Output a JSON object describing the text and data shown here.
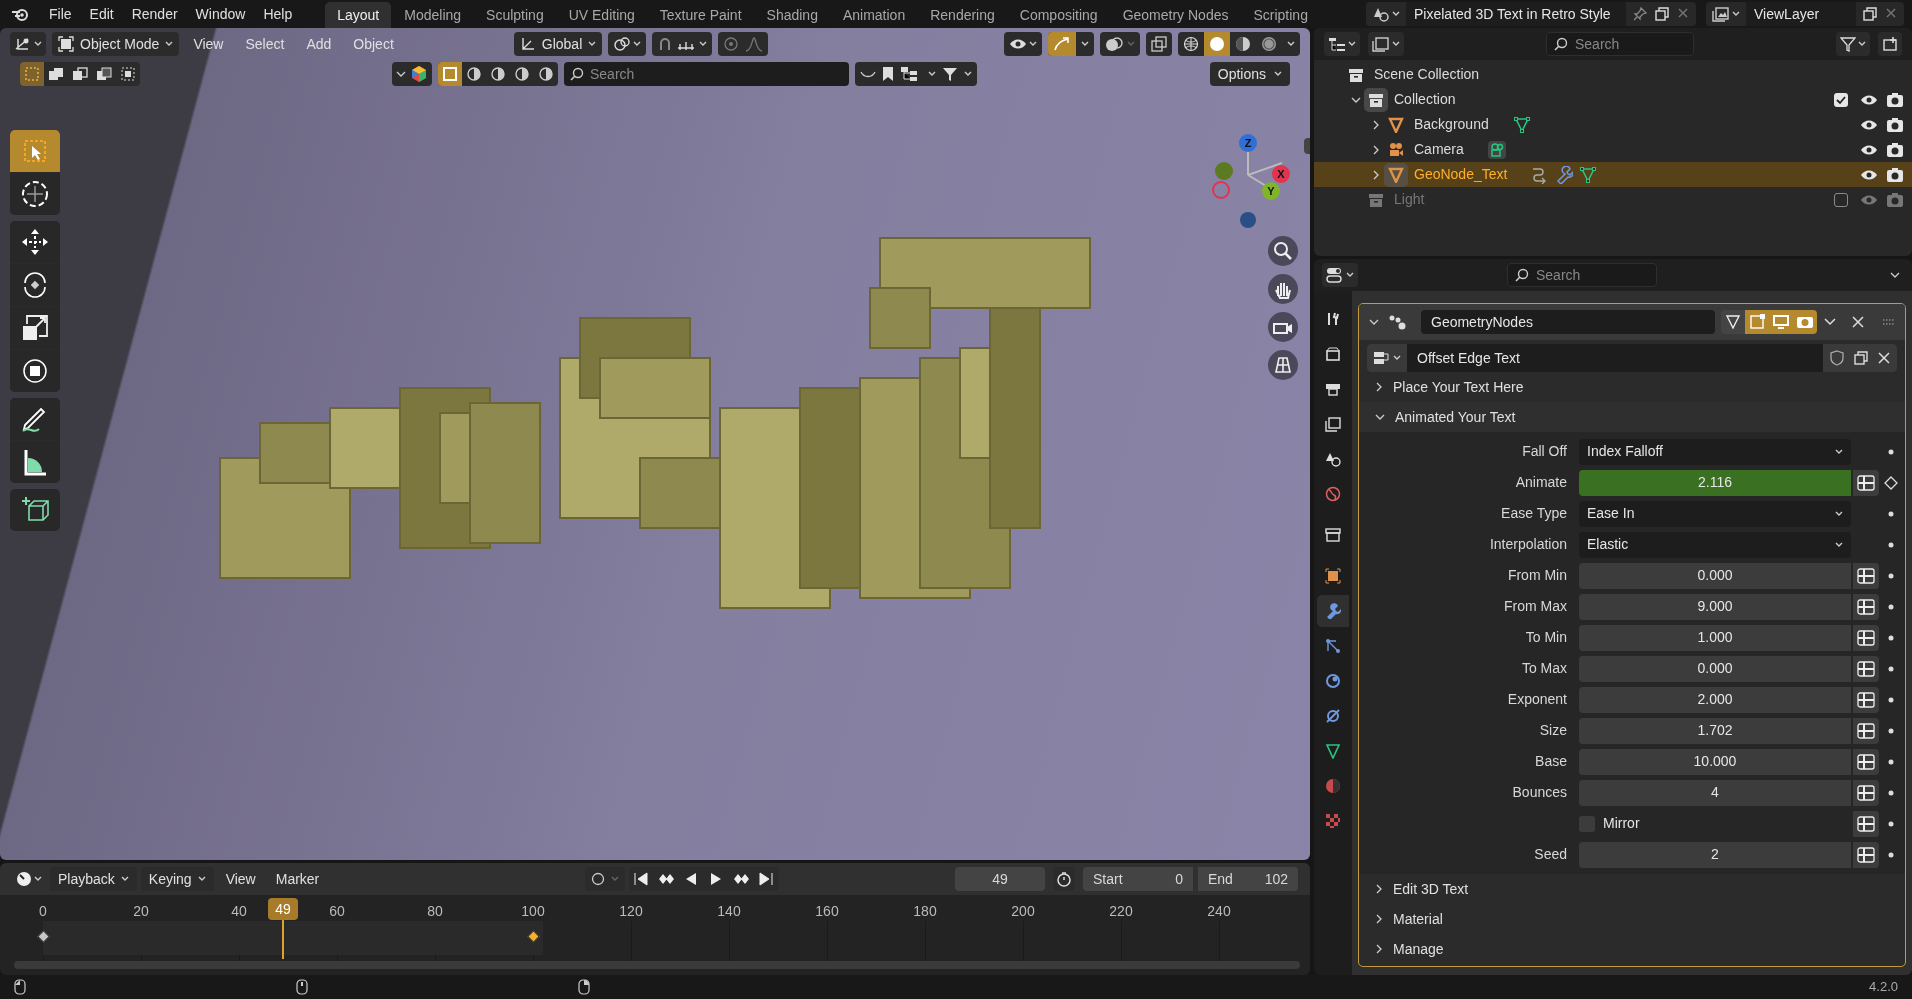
{
  "menu": [
    "File",
    "Edit",
    "Render",
    "Window",
    "Help"
  ],
  "workspaces": [
    {
      "label": "Layout",
      "selected": true
    },
    {
      "label": "Modeling",
      "selected": false
    },
    {
      "label": "Sculpting",
      "selected": false
    },
    {
      "label": "UV Editing",
      "selected": false
    },
    {
      "label": "Texture Paint",
      "selected": false
    },
    {
      "label": "Shading",
      "selected": false
    },
    {
      "label": "Animation",
      "selected": false
    },
    {
      "label": "Rendering",
      "selected": false
    },
    {
      "label": "Compositing",
      "selected": false
    },
    {
      "label": "Geometry Nodes",
      "selected": false
    },
    {
      "label": "Scripting",
      "selected": false
    }
  ],
  "scene": {
    "name": "Pixelated 3D Text in Retro Style"
  },
  "view_layer": {
    "name": "ViewLayer"
  },
  "viewport": {
    "mode": "Object Mode",
    "menus": [
      "View",
      "Select",
      "Add",
      "Object"
    ],
    "orientation": "Global",
    "search_placeholder": "Search",
    "options": "Options",
    "shading_modes": [
      {
        "kind": "wireframe",
        "selected": false
      },
      {
        "kind": "solid",
        "selected": true
      },
      {
        "kind": "material",
        "selected": false
      },
      {
        "kind": "rendered",
        "selected": false
      }
    ],
    "select_modes": [
      {
        "kind": "new",
        "selected": true
      },
      {
        "kind": "extend",
        "selected": false
      },
      {
        "kind": "subtract",
        "selected": false
      },
      {
        "kind": "invert",
        "selected": false
      },
      {
        "kind": "intersect",
        "selected": false
      }
    ],
    "tools": [
      {
        "kind": "select",
        "selected": true
      },
      {
        "kind": "cursor",
        "selected": false
      },
      {
        "kind": "move",
        "selected": false
      },
      {
        "kind": "rotate",
        "selected": false
      },
      {
        "kind": "scale",
        "selected": false
      },
      {
        "kind": "transform",
        "selected": false
      },
      {
        "kind": "annotate",
        "selected": false
      },
      {
        "kind": "measure",
        "selected": false
      },
      {
        "kind": "add-cube",
        "selected": false
      }
    ],
    "gizmo_axes": [
      {
        "label": "Z",
        "color": "#2f6fd6"
      },
      {
        "label": "X",
        "color": "#e0344f"
      },
      {
        "label": "Y",
        "color": "#80b52a"
      }
    ]
  },
  "outliner": {
    "search_placeholder": "Search",
    "items": [
      {
        "label": "Scene Collection",
        "kind": "collection",
        "children": [
          {
            "label": "Collection",
            "kind": "collection",
            "expanded": true,
            "included": true,
            "children": [
              {
                "label": "Background",
                "kind": "mesh",
                "expanded": false,
                "selected": false,
                "badges": [
                  {
                    "kind": "mesh-data"
                  }
                ]
              },
              {
                "label": "Camera",
                "kind": "camera",
                "expanded": false,
                "selected": false,
                "badges": [
                  {
                    "kind": "camera-data"
                  }
                ]
              },
              {
                "label": "GeoNode_Text",
                "kind": "mesh",
                "expanded": false,
                "selected": true,
                "badges": [
                  {
                    "kind": "curve"
                  },
                  {
                    "kind": "modifier"
                  },
                  {
                    "kind": "mesh-data"
                  }
                ]
              }
            ]
          },
          {
            "label": "Light",
            "kind": "collection",
            "included": false
          }
        ]
      }
    ]
  },
  "properties": {
    "search_placeholder": "Search",
    "tabs": [
      {
        "kind": "tool",
        "selected": false
      },
      {
        "kind": "render",
        "selected": false
      },
      {
        "kind": "output",
        "selected": false
      },
      {
        "kind": "view-layer",
        "selected": false
      },
      {
        "kind": "scene",
        "selected": false
      },
      {
        "kind": "world",
        "selected": false
      },
      {
        "kind": "collection",
        "selected": false
      },
      {
        "kind": "object",
        "selected": false
      },
      {
        "kind": "modifier",
        "selected": true
      },
      {
        "kind": "particles",
        "selected": false
      },
      {
        "kind": "physics",
        "selected": false
      },
      {
        "kind": "constraints",
        "selected": false
      },
      {
        "kind": "data",
        "selected": false
      },
      {
        "kind": "material",
        "selected": false
      },
      {
        "kind": "texture",
        "selected": false
      }
    ],
    "modifier": {
      "name": "GeometryNodes",
      "expanded": true,
      "node_group": "Offset Edge Text",
      "panels": [
        {
          "label": "Place Your Text Here",
          "expanded": false
        },
        {
          "label": "Animated Your Text",
          "expanded": true,
          "fields": [
            {
              "kind": "dropdown",
              "label": "Fall Off",
              "value": "Index Falloff",
              "keyed": false
            },
            {
              "kind": "number",
              "label": "Animate",
              "value": "2.116",
              "keyed": true
            },
            {
              "kind": "dropdown",
              "label": "Ease Type",
              "value": "Ease In",
              "keyed": false
            },
            {
              "kind": "dropdown",
              "label": "Interpolation",
              "value": "Elastic",
              "keyed": false
            },
            {
              "kind": "number",
              "label": "From Min",
              "value": "0.000",
              "keyed": false
            },
            {
              "kind": "number",
              "label": "From Max",
              "value": "9.000",
              "keyed": false
            },
            {
              "kind": "number",
              "label": "To Min",
              "value": "1.000",
              "keyed": false
            },
            {
              "kind": "number",
              "label": "To Max",
              "value": "0.000",
              "keyed": false
            },
            {
              "kind": "number",
              "label": "Exponent",
              "value": "2.000",
              "keyed": false
            },
            {
              "kind": "number",
              "label": "Size",
              "value": "1.702",
              "keyed": false
            },
            {
              "kind": "number",
              "label": "Base",
              "value": "10.000",
              "keyed": false
            },
            {
              "kind": "number",
              "label": "Bounces",
              "value": "4",
              "keyed": false
            },
            {
              "kind": "checkbox",
              "label": "Mirror",
              "checked": false,
              "keyed": false
            },
            {
              "kind": "number",
              "label": "Seed",
              "value": "2",
              "keyed": false
            }
          ]
        },
        {
          "label": "Edit 3D Text",
          "expanded": false
        },
        {
          "label": "Material",
          "expanded": false
        },
        {
          "label": "Manage",
          "expanded": false
        }
      ]
    }
  },
  "timeline": {
    "menus": [
      "Playback",
      "Keying",
      "View",
      "Marker"
    ],
    "current_frame": "49",
    "start_label": "Start",
    "start": "0",
    "end_label": "End",
    "end": "102",
    "playhead_label": "49",
    "ticks": [
      {
        "label": "0",
        "keyframe": {
          "selected": false
        }
      },
      {
        "label": "20"
      },
      {
        "label": "40"
      },
      {
        "label": "60"
      },
      {
        "label": "80"
      },
      {
        "label": "100",
        "keyframe": {
          "selected": true
        }
      },
      {
        "label": "120"
      },
      {
        "label": "140"
      },
      {
        "label": "160"
      },
      {
        "label": "180"
      },
      {
        "label": "200"
      },
      {
        "label": "220"
      },
      {
        "label": "240"
      }
    ]
  },
  "status_bar": {
    "version": "4.2.0"
  }
}
